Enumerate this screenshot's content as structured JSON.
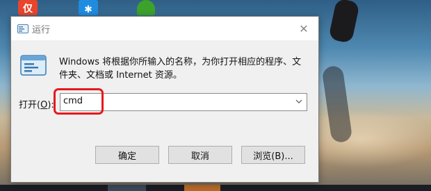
{
  "desktop": {
    "icons": [
      {
        "name": "app-icon-red",
        "glyph": "仅",
        "color": "#e8452c"
      },
      {
        "name": "app-icon-blue",
        "glyph": "✱",
        "color": "#1f8ce0"
      },
      {
        "name": "app-icon-green",
        "glyph": "",
        "color": "#3ca22c"
      }
    ]
  },
  "dialog": {
    "title": "运行",
    "close_glyph": "✕",
    "description": "Windows 将根据你所输入的名称，为你打开相应的程序、文件夹、文档或 Internet 资源。",
    "open_label_prefix": "打开(",
    "open_label_key": "O",
    "open_label_suffix": "):",
    "input_value": "cmd",
    "dropdown_glyph": "⌵",
    "buttons": {
      "ok": "确定",
      "cancel": "取消",
      "browse": "浏览(B)..."
    }
  },
  "colors": {
    "highlight": "#e5191c",
    "dialog_bg": "#f0f0f0",
    "button_bg": "#e1e1e1"
  }
}
